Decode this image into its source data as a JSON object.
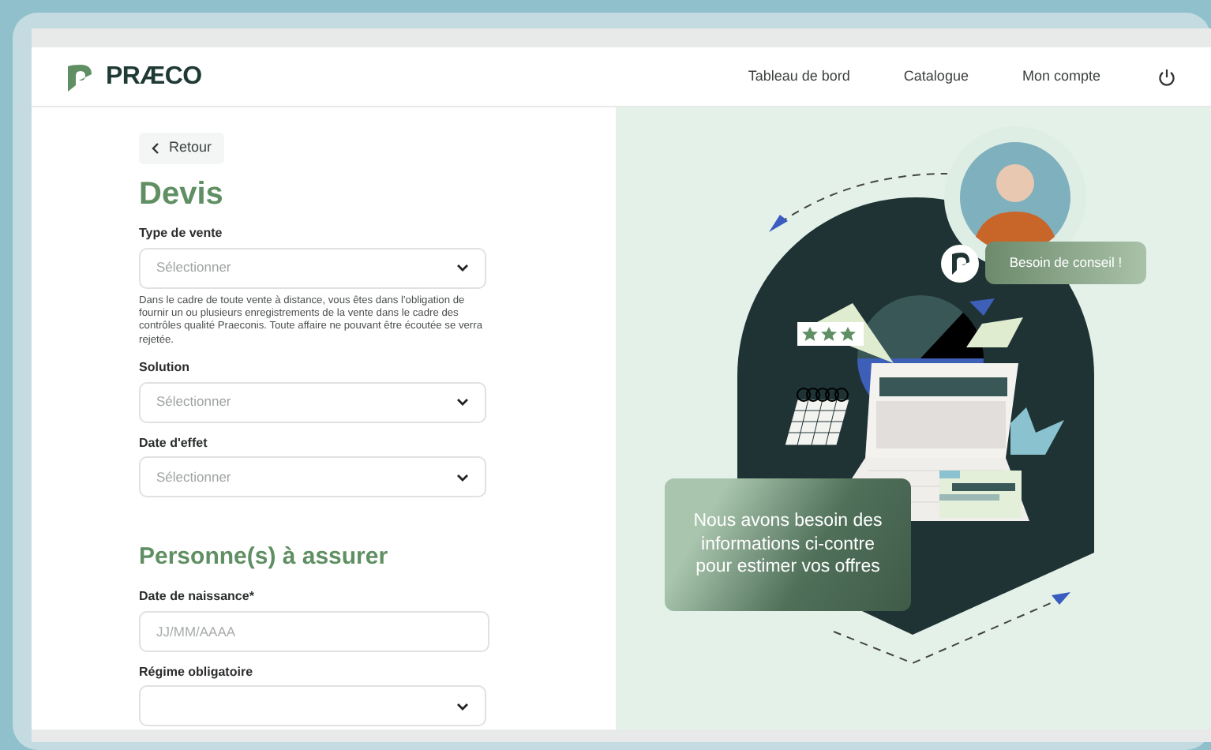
{
  "nav": {
    "brand": "PRÆCO",
    "links": [
      {
        "label": "Tableau de bord"
      },
      {
        "label": "Catalogue"
      },
      {
        "label": "Mon compte"
      }
    ]
  },
  "back": "Retour",
  "title": "Devis",
  "fields": [
    {
      "kind": "select",
      "label": "Type de vente",
      "placeholder": "Sélectionner",
      "help": "Dans le cadre de toute vente à distance, vous êtes dans l'obligation de fournir un ou plusieurs enregistrements de la vente dans le cadre des contrôles qualité Praeconis. Toute affaire ne pouvant être écoutée se verra rejetée."
    },
    {
      "kind": "select",
      "label": "Solution",
      "placeholder": "Sélectionner"
    },
    {
      "kind": "select",
      "label": "Date d'effet",
      "placeholder": "Sélectionner"
    }
  ],
  "section": {
    "title": "Personne(s) à assurer",
    "fields": [
      {
        "kind": "text",
        "label": "Date de naissance*",
        "placeholder": "JJ/MM/AAAA"
      },
      {
        "kind": "select",
        "label": "Régime obligatoire"
      }
    ]
  },
  "illustration": {
    "bubble": "Besoin de conseil !",
    "card": "Nous avons besoin des informations ci-contre pour estimer vos offres"
  }
}
